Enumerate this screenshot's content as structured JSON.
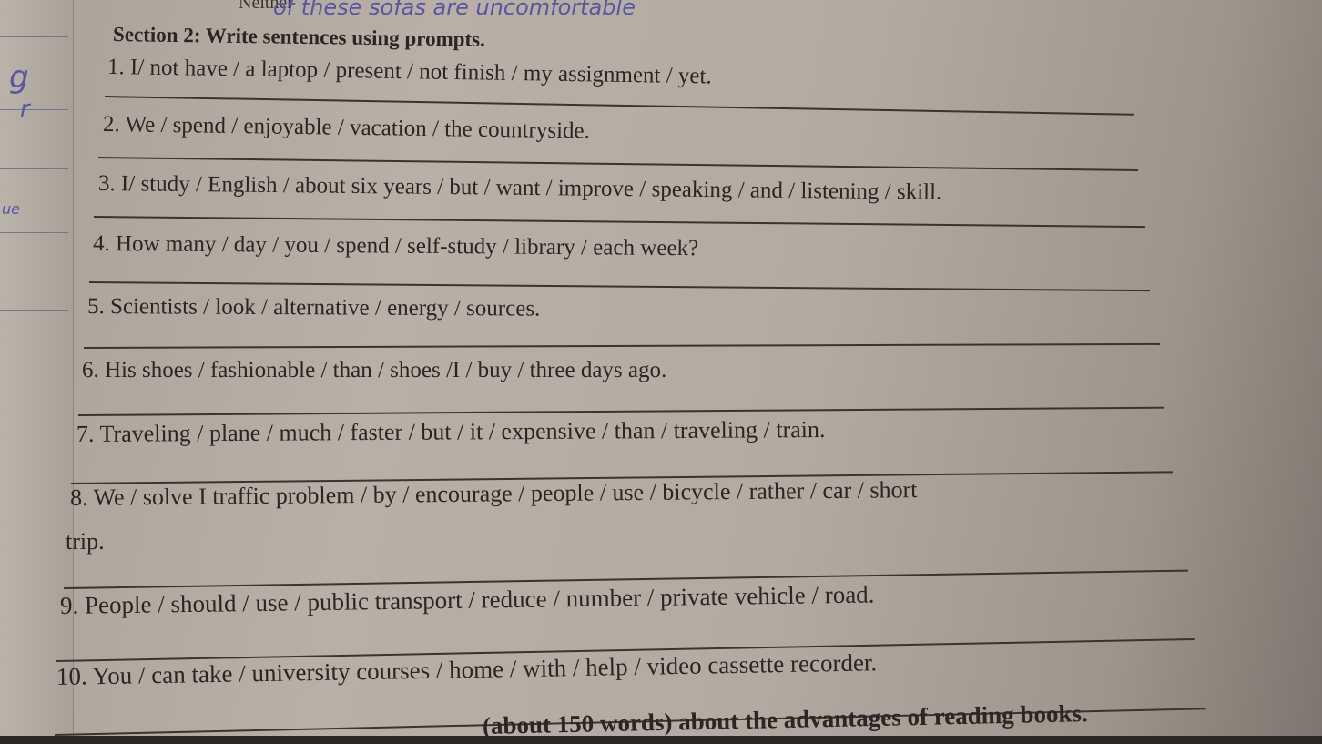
{
  "previous_item": {
    "printed": "Neither",
    "handwritten": "of these sofas are uncomfortable"
  },
  "section": {
    "title": "Section 2: Write sentences using prompts."
  },
  "prompts": [
    "1. I/ not have / a laptop / present / not finish / my assignment / yet.",
    "2. We / spend / enjoyable / vacation / the countryside.",
    "3. I/ study / English / about six years / but / want / improve / speaking / and / listening / skill.",
    "4. How many / day / you / spend / self-study / library / each week?",
    "5. Scientists / look / alternative / energy / sources.",
    "6. His shoes / fashionable / than / shoes /I / buy / three days ago.",
    "7. Traveling / plane / much / faster / but / it / expensive / than / traveling / train.",
    "8. We / solve I traffic problem / by / encourage / people / use / bicycle / rather / car / short",
    "trip.",
    "9. People / should / use / public transport / reduce / number / private vehicle / road.",
    "10. You / can take / university courses / home / with / help / video cassette recorder."
  ],
  "next_section_partial": "(about 150 words) about the advantages of reading books.",
  "margin_marks": [
    "g",
    "r",
    "ue"
  ]
}
